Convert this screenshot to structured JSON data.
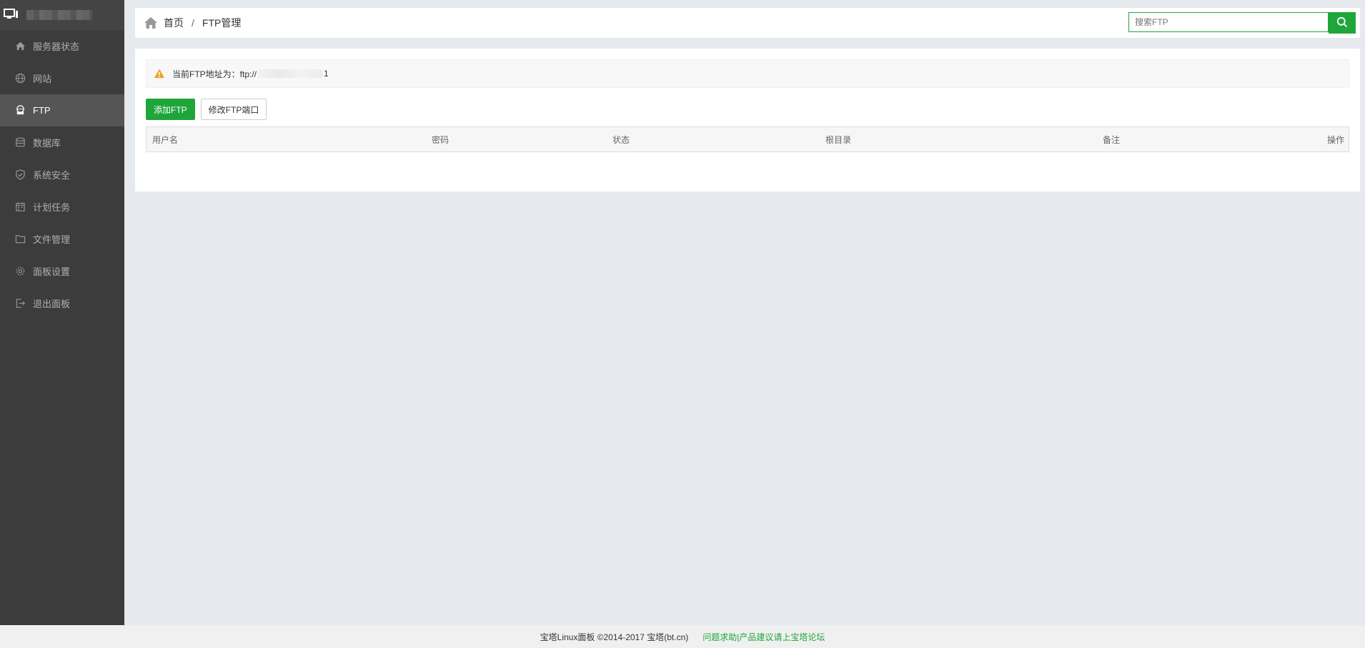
{
  "sidebar": {
    "items": [
      {
        "label": "服务器状态",
        "icon": "home-icon",
        "active": false
      },
      {
        "label": "网站",
        "icon": "globe-icon",
        "active": false
      },
      {
        "label": "FTP",
        "icon": "ftp-icon",
        "active": true
      },
      {
        "label": "数据库",
        "icon": "database-icon",
        "active": false
      },
      {
        "label": "系统安全",
        "icon": "shield-icon",
        "active": false
      },
      {
        "label": "计划任务",
        "icon": "calendar-icon",
        "active": false
      },
      {
        "label": "文件管理",
        "icon": "folder-icon",
        "active": false
      },
      {
        "label": "面板设置",
        "icon": "gear-icon",
        "active": false
      },
      {
        "label": "退出面板",
        "icon": "logout-icon",
        "active": false
      }
    ]
  },
  "breadcrumb": {
    "home": "首页",
    "separator": "/",
    "current": "FTP管理"
  },
  "search": {
    "placeholder": "搜索FTP"
  },
  "alert": {
    "prefix": "当前FTP地址为：ftp://",
    "suffix": "1"
  },
  "actions": {
    "add": "添加FTP",
    "change_port": "修改FTP端口"
  },
  "table": {
    "columns": [
      "用户名",
      "密码",
      "状态",
      "根目录",
      "备注",
      "操作"
    ]
  },
  "footer": {
    "copyright": "宝塔Linux面板 ©2014-2017 宝塔(bt.cn)",
    "links": "问题求助|产品建议请上宝塔论坛"
  },
  "colors": {
    "accent": "#20a53a",
    "sidebar_bg": "#3c3c3c",
    "warning": "#f0a020"
  }
}
